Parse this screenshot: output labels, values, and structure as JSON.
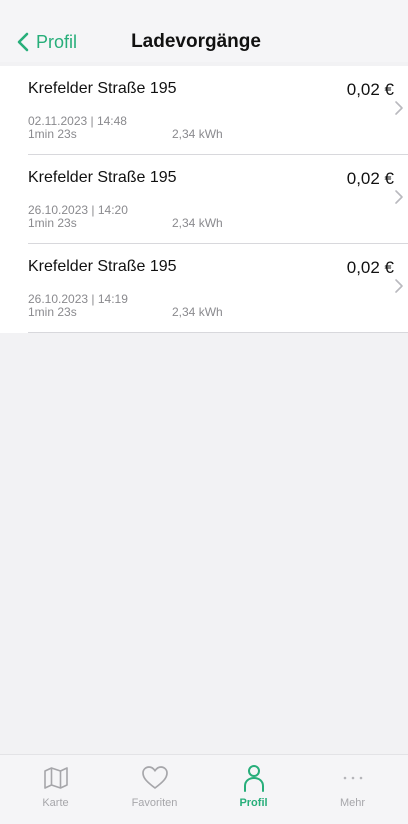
{
  "header": {
    "back_label": "Profil",
    "title": "Ladevorgänge"
  },
  "sessions": [
    {
      "station": "Krefelder Straße 195",
      "price": "0,02 €",
      "datetime": "02.11.2023 | 14:48",
      "duration": "1min 23s",
      "energy": "2,34 kWh"
    },
    {
      "station": "Krefelder Straße 195",
      "price": "0,02 €",
      "datetime": "26.10.2023 | 14:20",
      "duration": "1min 23s",
      "energy": "2,34 kWh"
    },
    {
      "station": "Krefelder Straße 195",
      "price": "0,02 €",
      "datetime": "26.10.2023 | 14:19",
      "duration": "1min 23s",
      "energy": "2,34 kWh"
    }
  ],
  "tabs": [
    {
      "label": "Karte",
      "icon": "map-icon",
      "active": false
    },
    {
      "label": "Favoriten",
      "icon": "heart-icon",
      "active": false
    },
    {
      "label": "Profil",
      "icon": "person-icon",
      "active": true
    },
    {
      "label": "Mehr",
      "icon": "more-icon",
      "active": false
    }
  ],
  "colors": {
    "accent": "#27ae7a",
    "inactive": "#a6a6aa"
  }
}
